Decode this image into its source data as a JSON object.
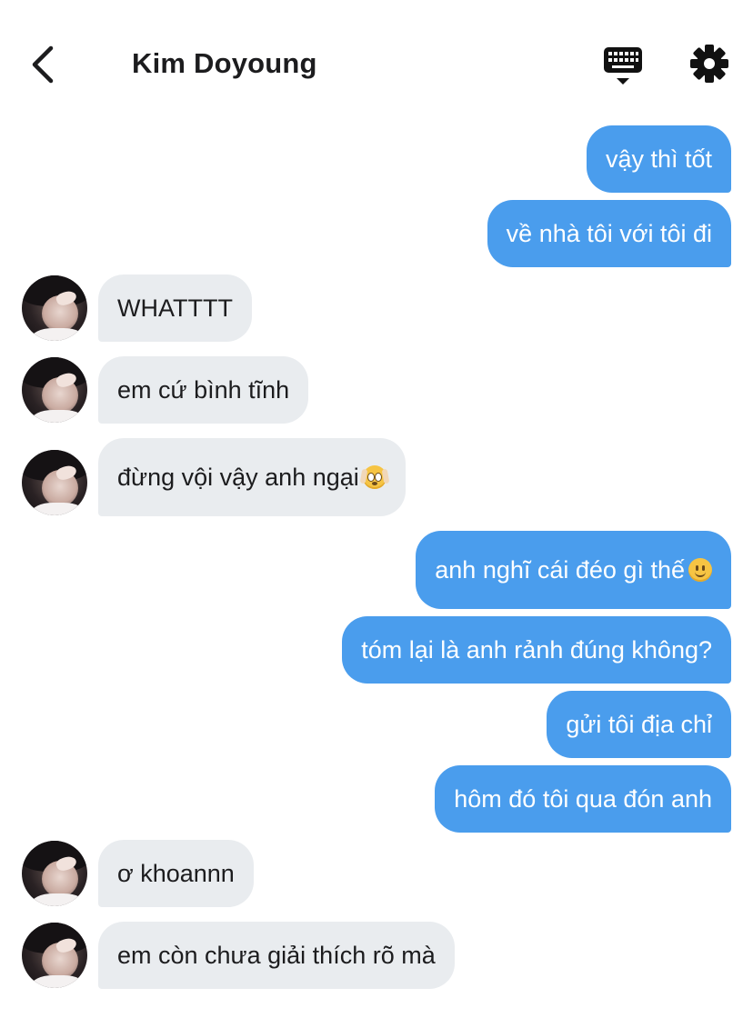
{
  "header": {
    "back_icon": "chevron-left-icon",
    "title": "Kim Doyoung",
    "keyboard_icon": "keyboard-icon",
    "settings_icon": "gear-icon"
  },
  "colors": {
    "outgoing_bubble": "#4a9ded",
    "incoming_bubble": "#e9ecef",
    "text_dark": "#1c1c1e"
  },
  "messages": [
    {
      "direction": "out",
      "text": "vậy thì tốt"
    },
    {
      "direction": "out",
      "text": "về nhà tôi với tôi đi"
    },
    {
      "direction": "in",
      "text": "WHATTTT"
    },
    {
      "direction": "in",
      "text": "em cứ bình tĩnh"
    },
    {
      "direction": "in",
      "text": "đừng vội vậy anh ngại",
      "emoji": "flushed-face-hands"
    },
    {
      "direction": "out",
      "text": "anh nghĩ cái đéo gì thế ",
      "emoji": "slightly-smiling-face"
    },
    {
      "direction": "out",
      "text": "tóm lại là anh rảnh đúng không?"
    },
    {
      "direction": "out",
      "text": "gửi tôi địa chỉ"
    },
    {
      "direction": "out",
      "text": "hôm đó tôi qua đón anh"
    },
    {
      "direction": "in",
      "text": "ơ khoannn"
    },
    {
      "direction": "in",
      "text": "em còn chưa giải thích rõ mà"
    }
  ]
}
